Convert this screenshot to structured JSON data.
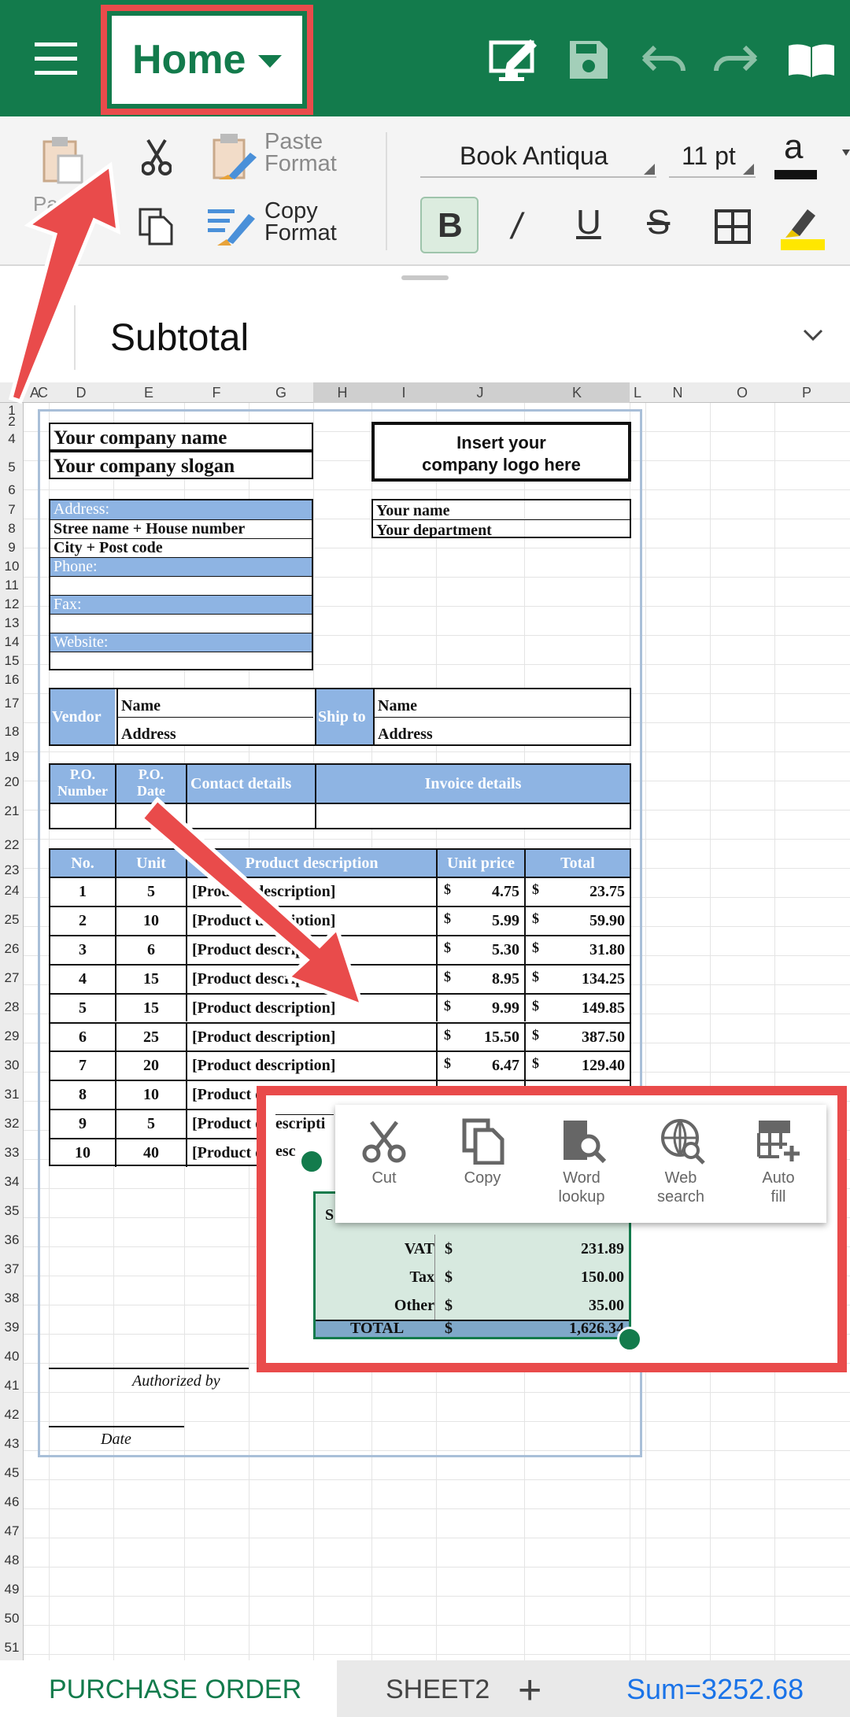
{
  "toolbar": {
    "title": "Home"
  },
  "ribbon": {
    "paste_label": "Pa",
    "paste_format_line1": "Paste",
    "paste_format_line2": "Format",
    "copy_format_line1": "Copy",
    "copy_format_line2": "Format",
    "font_name": "Book Antiqua",
    "font_size": "11 pt",
    "font_color_glyph": "a",
    "bold": "B",
    "italic": "/",
    "underline": "U",
    "strike": "S"
  },
  "formula_bar": {
    "cell_text": "Subtotal"
  },
  "columns": [
    "A",
    "C",
    "D",
    "E",
    "F",
    "G",
    "H",
    "I",
    "J",
    "K",
    "L",
    "N",
    "O",
    "P"
  ],
  "rows": [
    "1",
    "2",
    "4",
    "5",
    "6",
    "7",
    "8",
    "9",
    "10",
    "11",
    "12",
    "13",
    "14",
    "15",
    "16",
    "17",
    "18",
    "19",
    "20",
    "21",
    "22",
    "23",
    "24",
    "25",
    "26",
    "27",
    "28",
    "29",
    "30",
    "31",
    "32",
    "33",
    "34",
    "35",
    "36",
    "37",
    "38",
    "39",
    "40",
    "41",
    "42",
    "43",
    "45",
    "46",
    "47",
    "48",
    "49",
    "50",
    "51"
  ],
  "sheet": {
    "company_name": "Your company name",
    "company_slogan": "Your company slogan",
    "logo_line1": "Insert your",
    "logo_line2": "company logo here",
    "address_label": "Address:",
    "street": "Stree name + House number",
    "city": "City + Post code",
    "phone_label": "Phone:",
    "fax_label": "Fax:",
    "website_label": "Website:",
    "your_name": "Your name",
    "your_department": "Your department",
    "vendor_label": "Vendor",
    "vendor_name": "Name",
    "vendor_address": "Address",
    "shipto_label": "Ship to",
    "ship_name": "Name",
    "ship_address": "Address",
    "po_number_1": "P.O.",
    "po_number_2": "Number",
    "po_date_1": "P.O.",
    "po_date_2": "Date",
    "contact_details": "Contact details",
    "invoice_details": "Invoice details",
    "col_no": "No.",
    "col_unit": "Unit",
    "col_desc": "Product description",
    "col_price": "Unit price",
    "col_total": "Total",
    "currency": "$",
    "items": [
      {
        "no": "1",
        "unit": "5",
        "desc": "[Product description]",
        "price": "4.75",
        "total": "23.75"
      },
      {
        "no": "2",
        "unit": "10",
        "desc": "[Product description]",
        "price": "5.99",
        "total": "59.90"
      },
      {
        "no": "3",
        "unit": "6",
        "desc": "[Product description]",
        "price": "5.30",
        "total": "31.80"
      },
      {
        "no": "4",
        "unit": "15",
        "desc": "[Product description]",
        "price": "8.95",
        "total": "134.25"
      },
      {
        "no": "5",
        "unit": "15",
        "desc": "[Product description]",
        "price": "9.99",
        "total": "149.85"
      },
      {
        "no": "6",
        "unit": "25",
        "desc": "[Product description]",
        "price": "15.50",
        "total": "387.50"
      },
      {
        "no": "7",
        "unit": "20",
        "desc": "[Product description]",
        "price": "6.47",
        "total": "129.40"
      },
      {
        "no": "8",
        "unit": "10",
        "desc": "[Product description]",
        "price": "",
        "total": ""
      },
      {
        "no": "9",
        "unit": "5",
        "desc": "[Product description]",
        "price": "",
        "total": ""
      },
      {
        "no": "10",
        "unit": "40",
        "desc": "[Product description]",
        "price": "",
        "total": ""
      }
    ],
    "subtotal_fragment": "S",
    "vat_label": "VAT",
    "vat_value": "231.89",
    "tax_label": "Tax",
    "tax_value": "150.00",
    "other_label": "Other",
    "other_value": "35.00",
    "total_label": "TOTAL",
    "total_value": "1,626.34",
    "authorized_by": "Authorized by",
    "date_label": "Date"
  },
  "context_menu": {
    "cut": "Cut",
    "copy": "Copy",
    "word_lookup_1": "Word",
    "word_lookup_2": "lookup",
    "web_search_1": "Web",
    "web_search_2": "search",
    "auto_fill_1": "Auto",
    "auto_fill_2": "fill"
  },
  "bottom": {
    "tab_active": "PURCHASE ORDER",
    "tab_2": "SHEET2",
    "add": "+",
    "sum": "Sum=3252.68"
  },
  "colors": {
    "brand_green": "#137b4c",
    "header_blue": "#8eb4e3",
    "highlight_red": "#e94b4b",
    "selection_green": "#d7e9df",
    "link_blue": "#1a73e8"
  }
}
